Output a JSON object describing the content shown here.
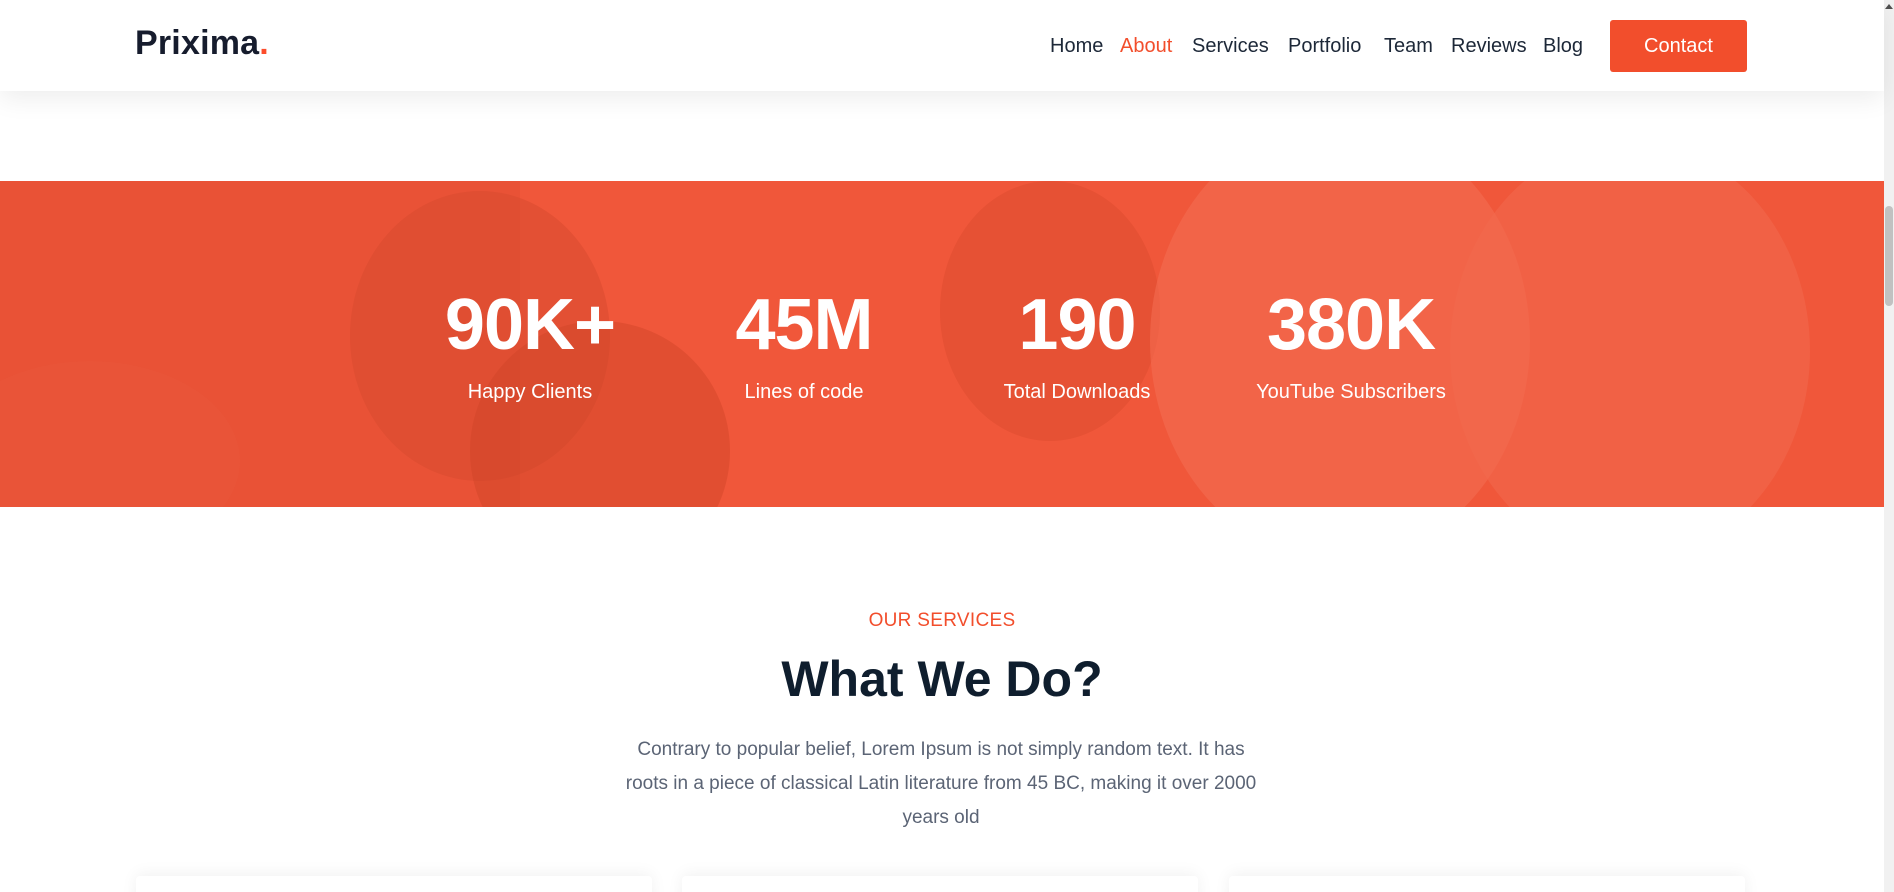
{
  "brand": {
    "name": "Prixima",
    "dot": ".",
    "accent": "#f24e2c"
  },
  "nav": {
    "items": [
      {
        "label": "Home",
        "active": false
      },
      {
        "label": "About",
        "active": true
      },
      {
        "label": "Services",
        "active": false
      },
      {
        "label": "Portfolio",
        "active": false
      },
      {
        "label": "Team",
        "active": false
      },
      {
        "label": "Reviews",
        "active": false
      },
      {
        "label": "Blog",
        "active": false
      }
    ],
    "contact_label": "Contact"
  },
  "stats": [
    {
      "number": "90K+",
      "label": "Happy Clients"
    },
    {
      "number": "45M",
      "label": "Lines of code"
    },
    {
      "number": "190",
      "label": "Total Downloads"
    },
    {
      "number": "380K",
      "label": "YouTube Subscribers"
    }
  ],
  "services": {
    "eyebrow": "OUR SERVICES",
    "title": "What We Do?",
    "text": "Contrary to popular belief, Lorem Ipsum is not simply random text. It has roots in a piece of classical Latin literature from 45 BC, making it over 2000 years old"
  },
  "colors": {
    "band": "#f0573a",
    "heading": "#0f1e2e",
    "body": "#5b6475"
  }
}
